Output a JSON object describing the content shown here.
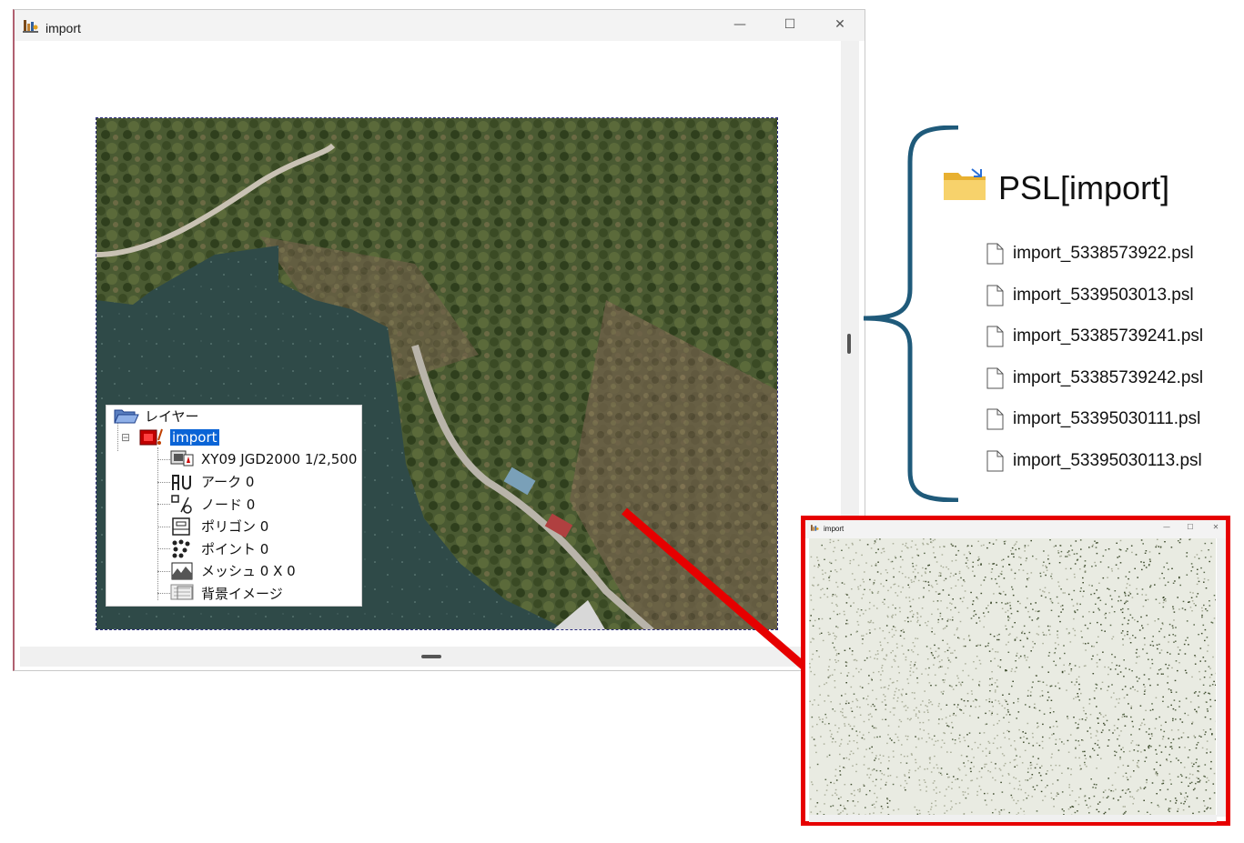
{
  "window": {
    "title": "import",
    "minimize_glyph": "—",
    "maximize_glyph": "☐",
    "close_glyph": "✕"
  },
  "layer_tree": {
    "root_label": "レイヤー",
    "layer_label": "import",
    "expander_glyph": "⊟",
    "items": [
      {
        "icon": "coordinate-system-icon",
        "label": "XY09 JGD2000 1/2,500"
      },
      {
        "icon": "arc-icon",
        "label": "アーク  0"
      },
      {
        "icon": "node-icon",
        "label": "ノード  0"
      },
      {
        "icon": "polygon-icon",
        "label": "ポリゴン  0"
      },
      {
        "icon": "point-icon",
        "label": "ポイント  0"
      },
      {
        "icon": "mesh-icon",
        "label": "メッシュ 0 X 0"
      },
      {
        "icon": "background-image-icon",
        "label": "背景イメージ"
      }
    ]
  },
  "folder": {
    "name": "PSL[import]",
    "files": [
      "import_5338573922.psl",
      "import_5339503013.psl",
      "import_53385739241.psl",
      "import_53385739242.psl",
      "import_53395030111.psl",
      "import_53395030113.psl"
    ]
  },
  "inset_window": {
    "title": "import",
    "minimize_glyph": "—",
    "maximize_glyph": "☐",
    "close_glyph": "✕"
  },
  "colors": {
    "brace": "#1f5a7a",
    "highlight": "#e60000",
    "selection": "#0a64d6",
    "folder_yellow": "#f5c542"
  }
}
